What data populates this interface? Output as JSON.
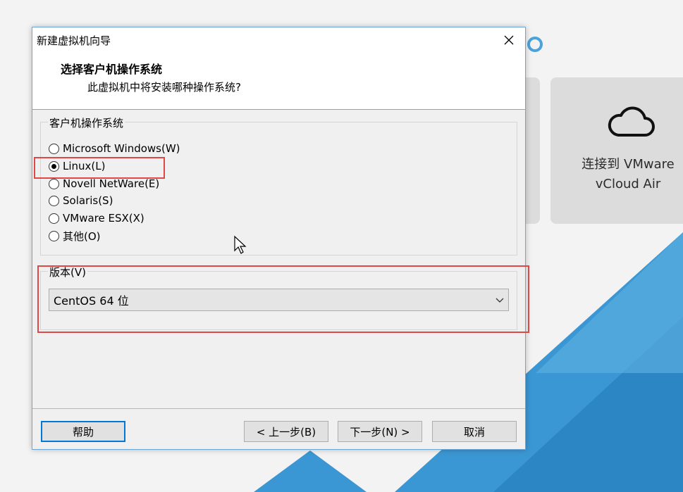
{
  "background_app": {
    "card_label": "连接到 VMware\nvCloud Air",
    "card_icon": "cloud-icon",
    "accent_color": "#4ba3d9"
  },
  "dialog": {
    "title": "新建虚拟机向导",
    "close_icon": "close-icon",
    "header_title": "选择客户机操作系统",
    "header_subtitle": "此虚拟机中将安装哪种操作系统?",
    "os_group_label": "客户机操作系统",
    "os_options": [
      {
        "label": "Microsoft Windows(W)",
        "checked": false
      },
      {
        "label": "Linux(L)",
        "checked": true
      },
      {
        "label": "Novell NetWare(E)",
        "checked": false
      },
      {
        "label": "Solaris(S)",
        "checked": false
      },
      {
        "label": "VMware ESX(X)",
        "checked": false
      },
      {
        "label": "其他(O)",
        "checked": false
      }
    ],
    "version_label": "版本(V)",
    "version_value": "CentOS 64 位",
    "buttons": {
      "help": "帮助",
      "back": "< 上一步(B)",
      "next": "下一步(N) >",
      "cancel": "取消"
    },
    "highlight_color": "#e04848"
  }
}
